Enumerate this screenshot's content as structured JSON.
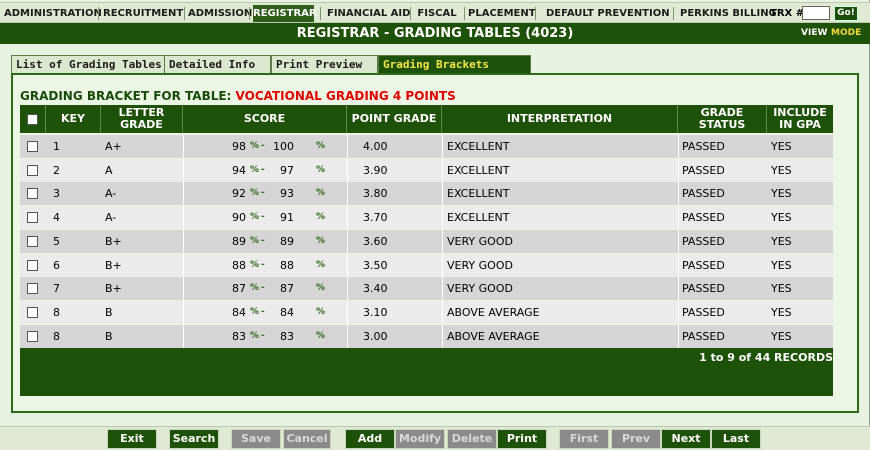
{
  "nav": {
    "items": [
      "ADMINISTRATION",
      "RECRUITMENT",
      "ADMISSION",
      "REGISTRAR",
      "FINANCIAL AID",
      "FISCAL",
      "PLACEMENT",
      "DEFAULT PREVENTION",
      "PERKINS BILLING"
    ],
    "active": "REGISTRAR",
    "trx_label": "TRX #:",
    "trx_value": "",
    "go_label": "Go!"
  },
  "title": "REGISTRAR - GRADING TABLES (4023)",
  "view_label": "VIEW",
  "mode_label": "MODE",
  "tabs": [
    "List of Grading Tables",
    "Detailed Info",
    "Print Preview",
    "Grading Brackets"
  ],
  "active_tab": "Grading Brackets",
  "heading": {
    "label": "GRADING BRACKET FOR TABLE:",
    "table_name": "VOCATIONAL GRADING 4 POINTS"
  },
  "columns": {
    "key": "KEY",
    "letter_line1": "LETTER",
    "letter_line2": "GRADE",
    "score": "SCORE",
    "point": "POINT GRADE",
    "interp": "INTERPRETATION",
    "status_line1": "GRADE",
    "status_line2": "STATUS",
    "gpa_line1": "INCLUDE",
    "gpa_line2": "IN GPA"
  },
  "pct_symbol": "%",
  "score_separator": "-",
  "rows": [
    {
      "key": "1",
      "letter": "A+",
      "low": "98",
      "high": "100",
      "point": "4.00",
      "interp": "EXCELLENT",
      "status": "PASSED",
      "gpa": "YES"
    },
    {
      "key": "2",
      "letter": "A",
      "low": "94",
      "high": "97",
      "point": "3.90",
      "interp": "EXCELLENT",
      "status": "PASSED",
      "gpa": "YES"
    },
    {
      "key": "3",
      "letter": "A-",
      "low": "92",
      "high": "93",
      "point": "3.80",
      "interp": "EXCELLENT",
      "status": "PASSED",
      "gpa": "YES"
    },
    {
      "key": "4",
      "letter": "A-",
      "low": "90",
      "high": "91",
      "point": "3.70",
      "interp": "EXCELLENT",
      "status": "PASSED",
      "gpa": "YES"
    },
    {
      "key": "5",
      "letter": "B+",
      "low": "89",
      "high": "89",
      "point": "3.60",
      "interp": "VERY GOOD",
      "status": "PASSED",
      "gpa": "YES"
    },
    {
      "key": "6",
      "letter": "B+",
      "low": "88",
      "high": "88",
      "point": "3.50",
      "interp": "VERY GOOD",
      "status": "PASSED",
      "gpa": "YES"
    },
    {
      "key": "7",
      "letter": "B+",
      "low": "87",
      "high": "87",
      "point": "3.40",
      "interp": "VERY GOOD",
      "status": "PASSED",
      "gpa": "YES"
    },
    {
      "key": "8",
      "letter": "B",
      "low": "84",
      "high": "84",
      "point": "3.10",
      "interp": "ABOVE AVERAGE",
      "status": "PASSED",
      "gpa": "YES"
    },
    {
      "key": "8",
      "letter": "B",
      "low": "83",
      "high": "83",
      "point": "3.00",
      "interp": "ABOVE AVERAGE",
      "status": "PASSED",
      "gpa": "YES"
    }
  ],
  "records_text": "1 to 9 of 44 RECORDS",
  "buttons": [
    {
      "label": "Exit",
      "enabled": true
    },
    {
      "label": "Search",
      "enabled": true
    },
    {
      "label": "Save",
      "enabled": false
    },
    {
      "label": "Cancel",
      "enabled": false
    },
    {
      "label": "Add",
      "enabled": true
    },
    {
      "label": "Modify",
      "enabled": false
    },
    {
      "label": "Delete",
      "enabled": false
    },
    {
      "label": "Print",
      "enabled": true
    },
    {
      "label": "First",
      "enabled": false
    },
    {
      "label": "Prev",
      "enabled": false
    },
    {
      "label": "Next",
      "enabled": true
    },
    {
      "label": "Last",
      "enabled": true
    }
  ]
}
